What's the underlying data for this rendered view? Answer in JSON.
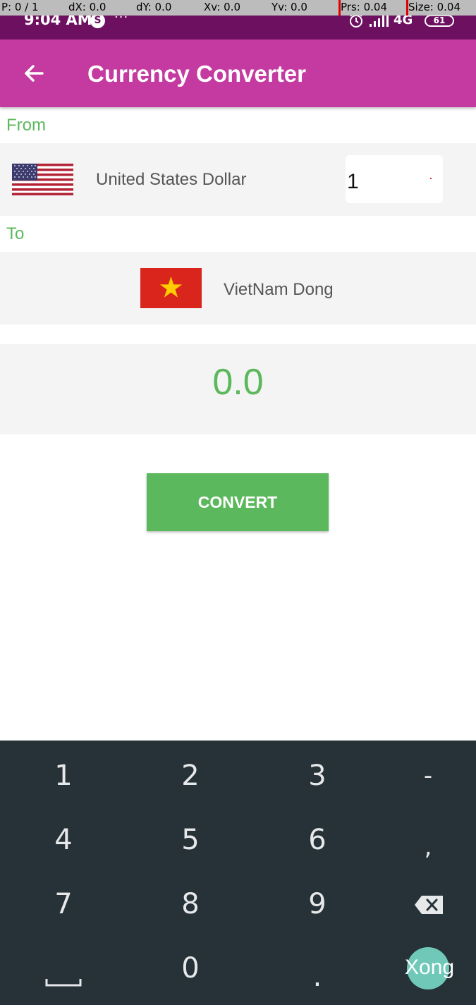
{
  "debug_overlay": {
    "pointer": "P: 0 / 1",
    "dx": "dX: 0.0",
    "dy": "dY: 0.0",
    "xv": "Xv: 0.0",
    "yv": "Yv: 0.0",
    "prs": "Prs: 0.04",
    "size": "Size: 0.04"
  },
  "status_bar": {
    "time": "9:04 AM",
    "app_icon": "S",
    "more": "···",
    "network": "4G",
    "battery": "61",
    "colors": {
      "background": "#6e1060"
    }
  },
  "app_bar": {
    "title": "Currency Converter",
    "back_icon": "arrow-left-icon",
    "colors": {
      "background": "#c43aa0"
    }
  },
  "from": {
    "label": "From",
    "currency": "United States Dollar",
    "flag": "us-flag",
    "amount": "1"
  },
  "to": {
    "label": "To",
    "currency": "VietNam Dong",
    "flag": "vietnam-flag"
  },
  "result": {
    "value": "0.0"
  },
  "convert_button": {
    "label": "CONVERT"
  },
  "keyboard": {
    "keys": {
      "k1": "1",
      "k2": "2",
      "k3": "3",
      "minus": "-",
      "k4": "4",
      "k5": "5",
      "k6": "6",
      "comma": ",",
      "k7": "7",
      "k8": "8",
      "k9": "9",
      "k0": "0",
      "period": "."
    },
    "done_label": "Xong",
    "colors": {
      "background": "#263238",
      "accent": "#6fc8b8"
    }
  },
  "colors": {
    "green": "#5cb85c",
    "row_background": "#f4f4f4"
  }
}
